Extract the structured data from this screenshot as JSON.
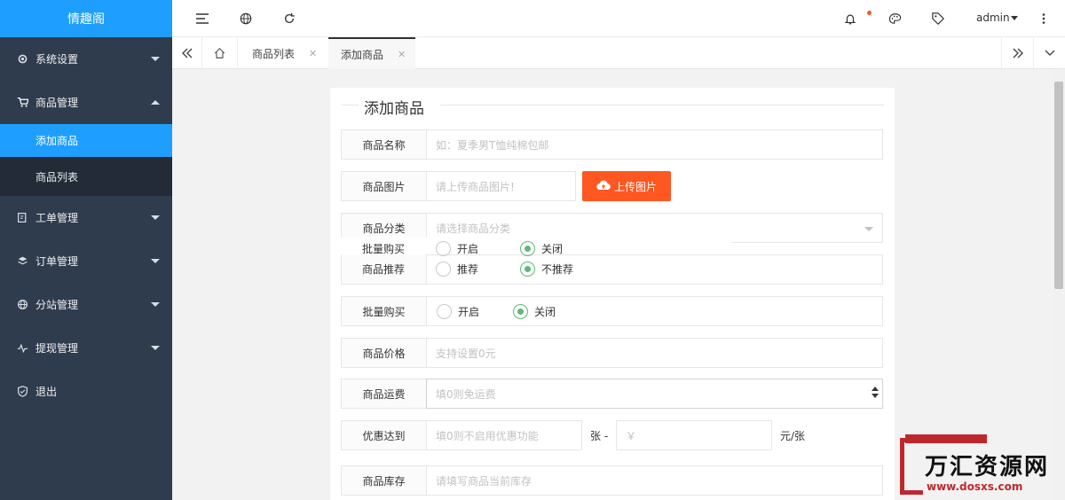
{
  "app": {
    "title": "情趣阁"
  },
  "sidebar": {
    "items": [
      {
        "label": "系统设置",
        "icon": "gear-icon",
        "expanded": false
      },
      {
        "label": "商品管理",
        "icon": "cart-icon",
        "expanded": true,
        "children": [
          {
            "label": "添加商品",
            "active": true
          },
          {
            "label": "商品列表",
            "active": false
          }
        ]
      },
      {
        "label": "工单管理",
        "icon": "ticket-icon",
        "expanded": false
      },
      {
        "label": "订单管理",
        "icon": "layers-icon",
        "expanded": false
      },
      {
        "label": "分站管理",
        "icon": "globe-icon",
        "expanded": false
      },
      {
        "label": "提现管理",
        "icon": "pulse-icon",
        "expanded": false
      },
      {
        "label": "退出",
        "icon": "shield-icon"
      }
    ]
  },
  "topbar": {
    "user": "admin"
  },
  "tabs": [
    {
      "label": "商品列表",
      "active": false
    },
    {
      "label": "添加商品",
      "active": true
    }
  ],
  "form": {
    "legend": "添加商品",
    "name": {
      "label": "商品名称",
      "placeholder": "如：夏季男T恤纯棉包邮"
    },
    "image": {
      "label": "商品图片",
      "placeholder": "请上传商品图片!",
      "upload_label": "上传图片"
    },
    "category": {
      "label": "商品分类",
      "placeholder": "请选择商品分类"
    },
    "overlay": {
      "bulk_label": "批量购买",
      "bulk_on": "开启",
      "bulk_off": "关闭",
      "recommend_label": "商品推荐",
      "rec_yes": "推荐",
      "rec_no": "不推荐"
    },
    "bulk": {
      "label": "批量购买",
      "on": "开启",
      "off": "关闭",
      "selected": "关闭"
    },
    "price": {
      "label": "商品价格",
      "placeholder": "支持设置0元"
    },
    "shipping": {
      "label": "商品运费",
      "placeholder": "填0则免运费"
    },
    "discount": {
      "label": "优惠达到",
      "placeholder": "填0则不启用优惠功能",
      "sep": "张 -",
      "price_placeholder": "￥",
      "unit": "元/张"
    },
    "stock": {
      "label": "商品库存",
      "placeholder": "请填写商品当前库存"
    }
  },
  "watermark": {
    "text": "万汇资源网",
    "url": "www.dosxs.com"
  },
  "colors": {
    "sidebar": "#2f3c4e",
    "accent": "#1e9fff",
    "upload": "#ff5722",
    "radio_on": "#5fb878"
  }
}
